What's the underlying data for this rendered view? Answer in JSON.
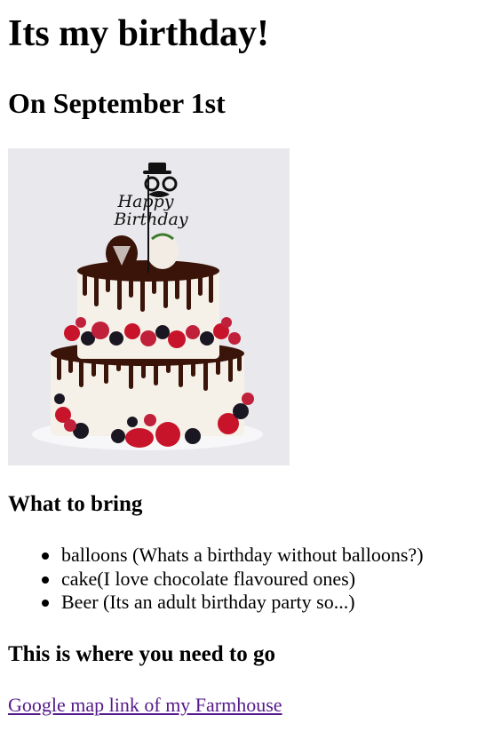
{
  "header": {
    "title": "Its my birthday!",
    "subtitle": "On September 1st"
  },
  "image": {
    "topper_text": "Happy Birthday",
    "colors": {
      "background": "#e9e8ec",
      "cream": "#f6f1e8",
      "chocolate": "#3a1408",
      "strawberry": "#c8142a",
      "blackberry": "#1b1722",
      "raspberry": "#c0203a"
    }
  },
  "bring": {
    "heading": "What to bring",
    "items": [
      {
        "label": "balloons (Whats a birthday without balloons?)"
      },
      {
        "label": "cake(I love chocolate flavoured ones)"
      },
      {
        "label": "Beer (Its an adult birthday party so...)"
      }
    ]
  },
  "location": {
    "heading": "This is where you need to go",
    "link_label": "Google map link of my Farmhouse",
    "link_color": "#551a8b"
  }
}
